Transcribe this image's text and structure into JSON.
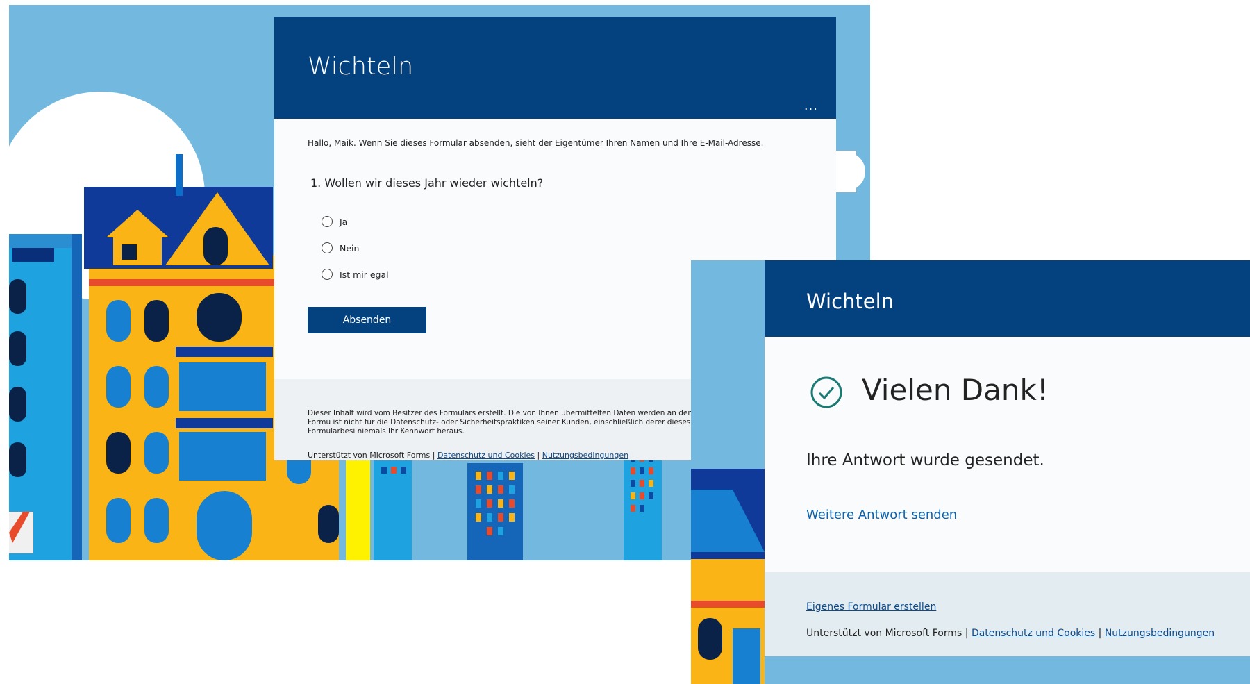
{
  "form": {
    "title": "Wichteln",
    "more_glyph": "...",
    "info": "Hallo, Maik. Wenn Sie dieses Formular absenden, sieht der Eigentümer Ihren Namen und Ihre E-Mail-Adresse.",
    "question": "1. Wollen wir dieses Jahr wieder wichteln?",
    "options": [
      "Ja",
      "Nein",
      "Ist mir egal"
    ],
    "submit_label": "Absenden",
    "disclaimer": "Dieser Inhalt wird vom Besitzer des Formulars erstellt. Die von Ihnen übermittelten Daten werden an den Formu ist nicht für die Datenschutz- oder Sicherheitspraktiken seiner Kunden, einschließlich derer dieses Formularbesi niemals Ihr Kennwort heraus.",
    "powered_by": "Unterstützt von Microsoft Forms | ",
    "privacy_link": "Datenschutz und Cookies",
    "separator": " | ",
    "terms_link": "Nutzungsbedingungen"
  },
  "confirmation": {
    "title": "Wichteln",
    "heading": "Vielen Dank!",
    "message": "Ihre Antwort wurde gesendet.",
    "another_response_link": "Weitere Antwort senden",
    "create_own_link": "Eigenes Formular erstellen",
    "powered_by": "Unterstützt von Microsoft Forms | ",
    "privacy_link": "Datenschutz und Cookies",
    "separator": " | ",
    "terms_link": "Nutzungsbedingungen"
  },
  "colors": {
    "header_blue": "#03417f",
    "sky": "#73b9df",
    "check_teal": "#1b7a74",
    "link_blue": "#0b63b0"
  }
}
